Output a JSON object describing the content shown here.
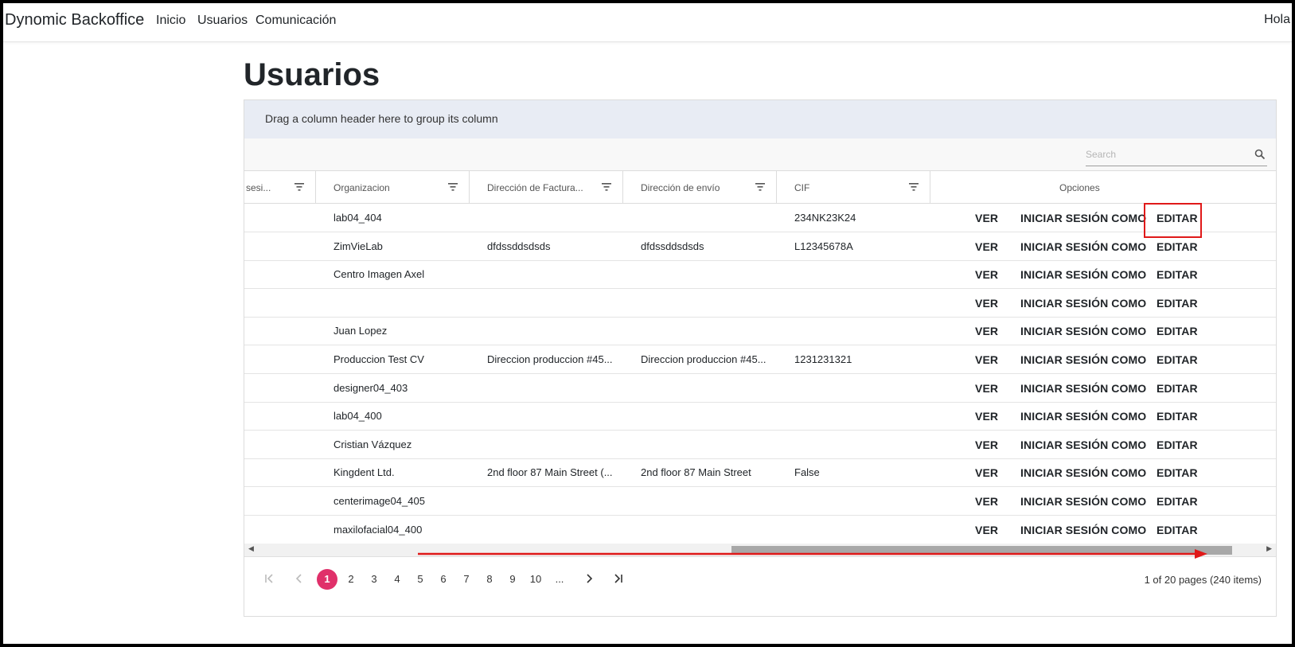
{
  "navbar": {
    "brand": "Dynomic Backoffice",
    "links": [
      "Inicio",
      "Usuarios",
      "Comunicación"
    ],
    "greeting": "Hola"
  },
  "page": {
    "title": "Usuarios"
  },
  "grid": {
    "group_panel_text": "Drag a column header here to group its column",
    "search_placeholder": "Search",
    "columns": {
      "c0": "sesi...",
      "c1": "Organizacion",
      "c2": "Dirección de Factura...",
      "c3": "Dirección de envío",
      "c4": "CIF",
      "options": "Opciones"
    },
    "actions": {
      "ver": "VER",
      "iniciar": "INICIAR SESIÓN COMO",
      "editar": "EDITAR"
    },
    "rows": [
      {
        "org": "lab04_404",
        "billing": "",
        "shipping": "",
        "cif": "234NK23K24"
      },
      {
        "org": "ZimVieLab",
        "billing": "dfdssddsdsds",
        "shipping": "dfdssddsdsds",
        "cif": "L12345678A"
      },
      {
        "org": "Centro Imagen Axel",
        "billing": "",
        "shipping": "",
        "cif": ""
      },
      {
        "org": "",
        "billing": "",
        "shipping": "",
        "cif": ""
      },
      {
        "org": "Juan Lopez",
        "billing": "",
        "shipping": "",
        "cif": ""
      },
      {
        "org": "Produccion Test CV",
        "billing": "Direccion produccion #45...",
        "shipping": "Direccion produccion #45...",
        "cif": "1231231321"
      },
      {
        "org": "designer04_403",
        "billing": "",
        "shipping": "",
        "cif": ""
      },
      {
        "org": "lab04_400",
        "billing": "",
        "shipping": "",
        "cif": ""
      },
      {
        "org": "Cristian Vázquez",
        "billing": "",
        "shipping": "",
        "cif": ""
      },
      {
        "org": "Kingdent Ltd.",
        "billing": "2nd floor 87 Main Street (...",
        "shipping": "2nd floor 87 Main Street",
        "cif": "False"
      },
      {
        "org": "centerimage04_405",
        "billing": "",
        "shipping": "",
        "cif": ""
      },
      {
        "org": "maxilofacial04_400",
        "billing": "",
        "shipping": "",
        "cif": ""
      }
    ],
    "pager": {
      "pages": [
        "1",
        "2",
        "3",
        "4",
        "5",
        "6",
        "7",
        "8",
        "9",
        "10",
        "..."
      ],
      "current": "1",
      "info": "1 of 20 pages (240 items)"
    }
  },
  "colors": {
    "accent": "#e0306a",
    "highlight": "#e01919",
    "group_panel_bg": "#e8ecf4"
  },
  "icons": [
    "search-icon",
    "filter-icon",
    "first-page-icon",
    "prev-page-icon",
    "next-page-icon",
    "last-page-icon"
  ]
}
